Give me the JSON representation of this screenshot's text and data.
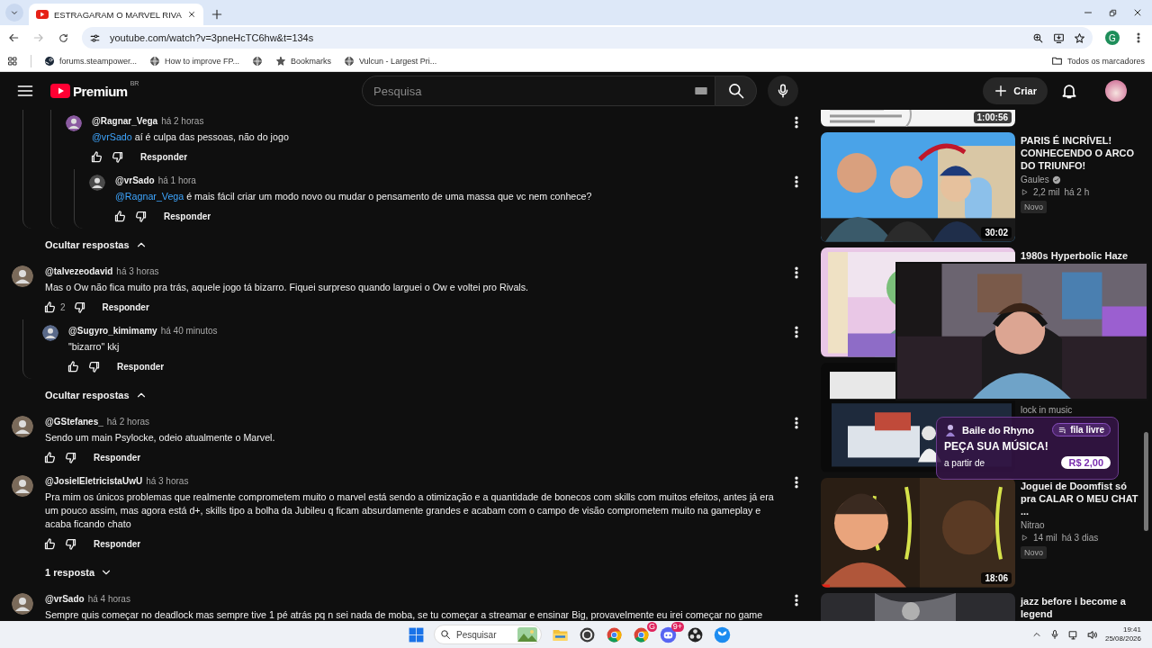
{
  "browser": {
    "tab": {
      "title": "ESTRAGARAM O MARVEL RIVA",
      "selected": true
    },
    "url": "youtube.com/watch?v=3pneHcTC6hw&t=134s",
    "profile_initial": "G",
    "bookmarks": [
      {
        "kind": "steam",
        "label": "forums.steampower..."
      },
      {
        "kind": "globe",
        "label": "How to improve FP..."
      },
      {
        "kind": "globe"
      },
      {
        "kind": "star",
        "label": "Bookmarks"
      },
      {
        "kind": "globe",
        "label": "Vulcun - Largest Pri..."
      }
    ],
    "all_bookmarks": "Todos os marcadores"
  },
  "header": {
    "logo": "Premium",
    "region": "BR",
    "search": {
      "placeholder": "Pesquisa"
    },
    "create": "Criar"
  },
  "comments": [
    {
      "replies": [
        {
          "replies": [
            {
              "author": "@Ragnar_Vega",
              "time": "há 2 horas",
              "mention": "@vrSado",
              "text": "aí é culpa das pessoas, não do jogo",
              "reply": "Responder",
              "replies": [
                {
                  "author": "@vrSado",
                  "time": "há 1 hora",
                  "mention": "@Ragnar_Vega",
                  "text": "é mais fácil criar um modo novo ou mudar o pensamento de uma massa que vc nem conhece?",
                  "reply": "Responder"
                }
              ]
            }
          ]
        }
      ],
      "replies_toggle": {
        "label": "Ocultar respostas",
        "expanded": true
      }
    },
    {
      "author": "@talvezeodavid",
      "time": "há 3 horas",
      "text": "Mas o Ow não fica muito pra trás, aquele jogo tá bizarro. Fiquei surpreso quando larguei o Ow e voltei pro Rivals.",
      "likes": "2",
      "reply": "Responder",
      "replies": [
        {
          "author": "@Sugyro_kimimamy",
          "time": "há 40 minutos",
          "text": "\"bizarro\" kkj",
          "reply": "Responder"
        }
      ],
      "replies_toggle": {
        "label": "Ocultar respostas",
        "expanded": true
      }
    },
    {
      "author": "@GStefanes_",
      "time": "há 2 horas",
      "text": "Sendo um main Psylocke, odeio atualmente o Marvel.",
      "reply": "Responder"
    },
    {
      "author": "@JosielEletricistaUwU",
      "time": "há 3 horas",
      "text": "Pra mim os únicos problemas que realmente comprometem muito o marvel está sendo a otimização e a quantidade de bonecos com skills com muitos efeitos, antes já era um pouco assim, mas agora está d+, skills tipo a bolha da Jubileu q ficam absurdamente grandes e acabam com o campo de visão comprometem muito na gameplay e acaba ficando chato",
      "reply": "Responder",
      "replies_toggle": {
        "label": "1 resposta",
        "expanded": false
      }
    },
    {
      "author": "@vrSado",
      "time": "há 4 horas",
      "text": "Sempre quis começar no deadlock mas sempre tive 1 pé atrás pq n sei nada de moba, se tu começar a streamar e ensinar Big, provavelmente eu irei começar no game"
    }
  ],
  "sidebar": {
    "videos": [
      {
        "duration": "1:00:56"
      },
      {
        "title": "PARIS É INCRÍVEL! CONHECENDO O ARCO DO TRIUNFO!",
        "channel": "Gaules",
        "verified": true,
        "views": "2,2 mil",
        "age": "há 2 h",
        "badge": "Novo",
        "duration": "30:02"
      },
      {
        "title": "1980s Hyperbolic Haze"
      },
      {
        "channel": "lock in music"
      },
      {
        "title": "Joguei de Doomfist só pra CALAR O MEU CHAT ...",
        "channel": "Nitrao",
        "views": "14 mil",
        "age": "há 3 dias",
        "badge": "Novo",
        "duration": "18:06"
      },
      {
        "title": "jazz before i become a legend"
      }
    ]
  },
  "overlays": {
    "song_request": {
      "name": "Baile do Rhyno",
      "status": "fila livre",
      "headline": "PEÇA SUA MÚSICA!",
      "price_prefix": "a partir de",
      "price": "R$ 2,00"
    }
  },
  "taskbar": {
    "search": {
      "placeholder": "Pesquisar"
    },
    "apps": [
      {
        "kind": "folder"
      },
      {
        "kind": "game"
      },
      {
        "kind": "browser"
      },
      {
        "kind": "browser",
        "badge": "G"
      },
      {
        "kind": "chat",
        "badge": "9+"
      },
      {
        "kind": "recorder"
      },
      {
        "kind": "bluesky"
      }
    ],
    "time": "19:41",
    "date": "25/08/2026"
  }
}
